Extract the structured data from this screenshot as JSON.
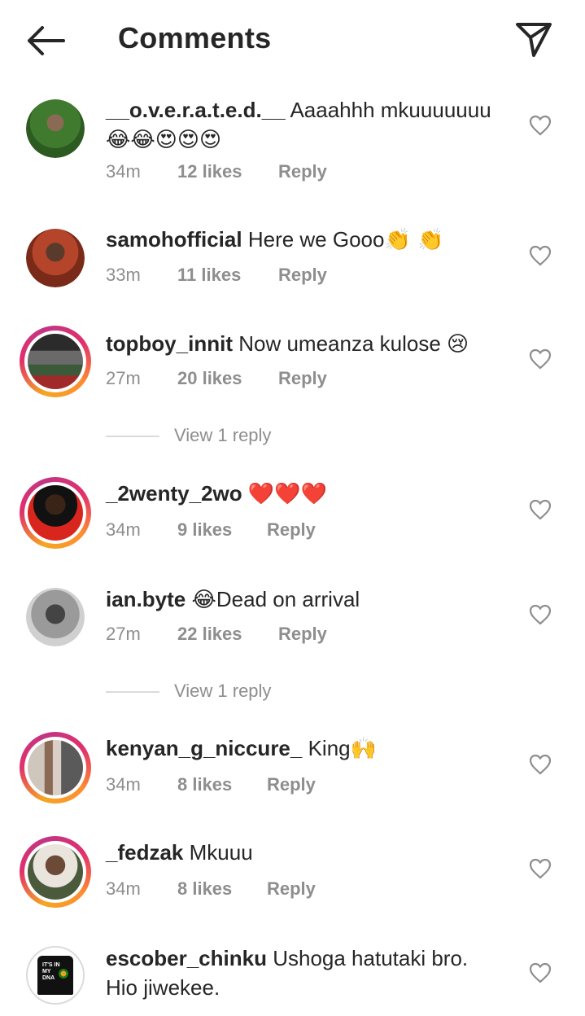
{
  "header": {
    "title": "Comments",
    "back_icon": "back-arrow-icon",
    "send_icon": "send-icon"
  },
  "comments": [
    {
      "username": "__o.v.e.r.a.t.e.d.__",
      "text": "Aaaahhh mkuuuuuuu",
      "emoji": "😂😂😍😍😍",
      "time": "34m",
      "likes": "12 likes",
      "reply": "Reply"
    },
    {
      "username": "samohofficial",
      "text": "Here we Gooo",
      "emoji": "👏 👏",
      "time": "33m",
      "likes": "11 likes",
      "reply": "Reply"
    },
    {
      "username": "topboy_innit",
      "text": "Now umeanza kulose",
      "emoji": "😢",
      "time": "27m",
      "likes": "20 likes",
      "reply": "Reply",
      "view_replies": "View 1 reply"
    },
    {
      "username": "_2wenty_2wo",
      "text": "",
      "emoji": "❤️❤️❤️",
      "time": "34m",
      "likes": "9 likes",
      "reply": "Reply"
    },
    {
      "username": "ian.byte",
      "text": "Dead on arrival",
      "emoji": "😂",
      "time": "27m",
      "likes": "22 likes",
      "reply": "Reply",
      "view_replies": "View 1 reply"
    },
    {
      "username": "kenyan_g_niccure_",
      "text": "King",
      "emoji": "🙌",
      "time": "34m",
      "likes": "8 likes",
      "reply": "Reply"
    },
    {
      "username": "_fedzak",
      "text": "Mkuuu",
      "time": "34m",
      "likes": "8 likes",
      "reply": "Reply"
    },
    {
      "username": "escober_chinku",
      "text": "Ushoga hatutaki bro.",
      "text_line2": "Hio jiwekee."
    }
  ],
  "avatar_text": {
    "escober": "IT'S IN MY DNA"
  },
  "colors": {
    "text": "#262626",
    "muted": "#8e8e8e",
    "divider": "#dbdbdb",
    "story_ring_start": "#f5a623",
    "story_ring_end": "#c13584"
  }
}
